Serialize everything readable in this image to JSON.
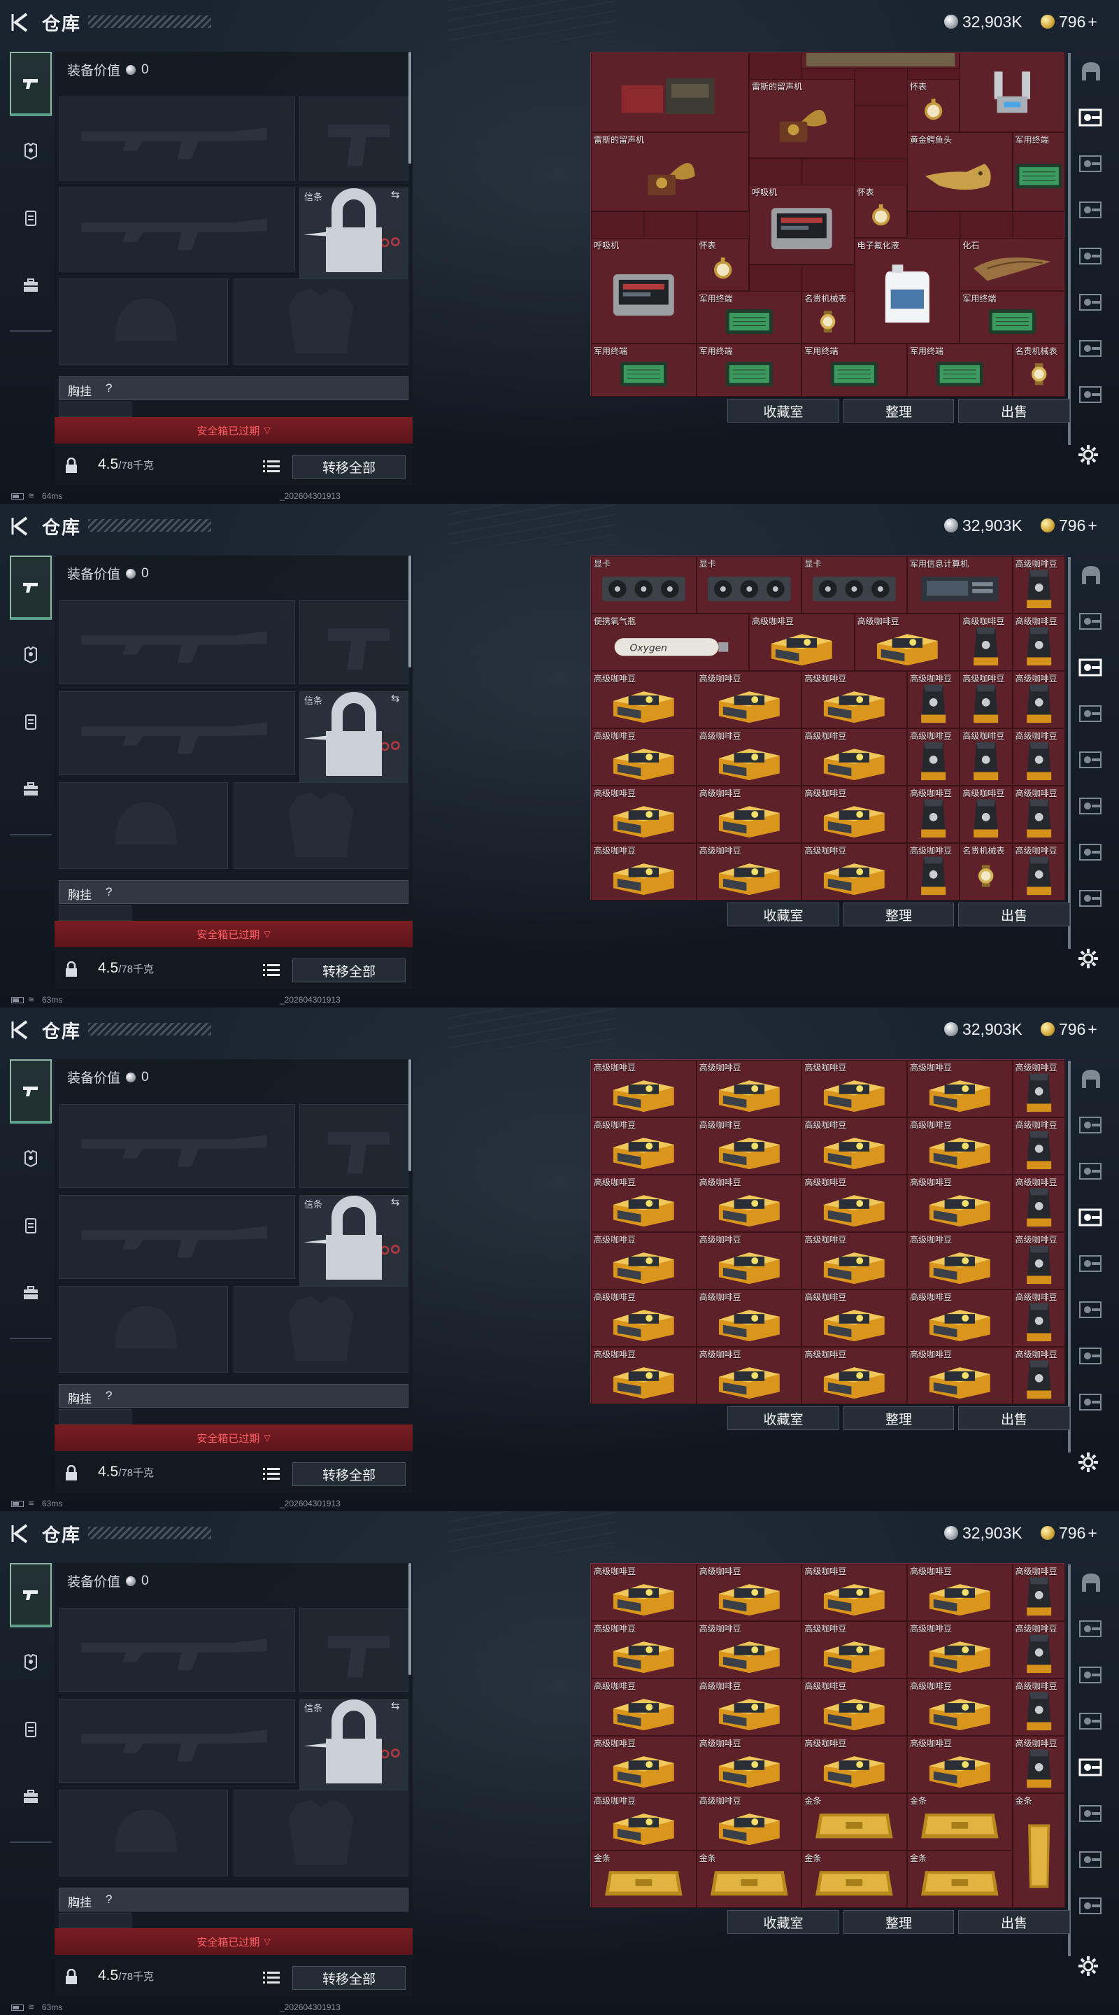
{
  "header": {
    "title": "仓库",
    "silver": "32,903K",
    "gold": "796",
    "gold_plus": "+"
  },
  "loadout": {
    "equip_value_label": "装备价值",
    "equip_value": "0",
    "melee_label": "信条",
    "vest_label": "胸挂",
    "vest_value": "?",
    "safebox_text": "安全箱已过期",
    "weight_value": "4.5",
    "weight_max": "/78千克",
    "transfer_all": "转移全部"
  },
  "status": {
    "ping": [
      "64ms",
      "63ms",
      "63ms",
      "63ms"
    ],
    "uid": "_202604301913"
  },
  "buttons": {
    "collection": "收藏室",
    "sort": "整理",
    "sell": "出售"
  },
  "rail_icons": [
    "helmet-icon",
    "key-icon",
    "key-icon",
    "key-icon",
    "key-icon",
    "key-icon",
    "key-icon",
    "key-icon"
  ],
  "colors": {
    "grid_bg": "#571a22",
    "safebox": "#7a1d22",
    "active_tab": "#5c9f88"
  },
  "panels": [
    {
      "rail_active": 1,
      "items": [
        {
          "label": "",
          "icon": "radio-device",
          "c": 0,
          "r": 0,
          "w": 3,
          "h": 1.5
        },
        {
          "label": "",
          "icon": "crate",
          "c": 4,
          "r": 0,
          "w": 3,
          "h": 0.3
        },
        {
          "label": "",
          "icon": "robot-arm",
          "c": 7,
          "r": 0,
          "w": 2,
          "h": 1.5
        },
        {
          "label": "雷斯的留声机",
          "icon": "gramophone",
          "c": 3,
          "r": 0.5,
          "w": 2,
          "h": 1.5
        },
        {
          "label": "怀表",
          "icon": "pocket-watch",
          "c": 6,
          "r": 0.5,
          "w": 1,
          "h": 1
        },
        {
          "label": "雷斯的留声机",
          "icon": "gramophone",
          "c": 0,
          "r": 1.5,
          "w": 3,
          "h": 1.5
        },
        {
          "label": "黄金鳄鱼头",
          "icon": "croc-head",
          "c": 6,
          "r": 1.5,
          "w": 2,
          "h": 1.5
        },
        {
          "label": "军用终端",
          "icon": "terminal",
          "c": 8,
          "r": 1.5,
          "w": 1,
          "h": 1.5
        },
        {
          "label": "呼吸机",
          "icon": "respirator",
          "c": 3,
          "r": 2.5,
          "w": 2,
          "h": 1.5
        },
        {
          "label": "怀表",
          "icon": "pocket-watch",
          "c": 5,
          "r": 2.5,
          "w": 1,
          "h": 1
        },
        {
          "label": "呼吸机",
          "icon": "respirator",
          "c": 0,
          "r": 3.5,
          "w": 2,
          "h": 2
        },
        {
          "label": "怀表",
          "icon": "pocket-watch",
          "c": 2,
          "r": 3.5,
          "w": 1,
          "h": 1
        },
        {
          "label": "电子氟化液",
          "icon": "jug",
          "c": 5,
          "r": 3.5,
          "w": 2,
          "h": 2
        },
        {
          "label": "化石",
          "icon": "fossil",
          "c": 7,
          "r": 3.5,
          "w": 2,
          "h": 1
        },
        {
          "label": "军用终端",
          "icon": "terminal",
          "c": 2,
          "r": 4.5,
          "w": 2,
          "h": 1
        },
        {
          "label": "名贵机械表",
          "icon": "watch",
          "c": 4,
          "r": 4.5,
          "w": 1,
          "h": 1
        },
        {
          "label": "军用终端",
          "icon": "terminal",
          "c": 7,
          "r": 4.5,
          "w": 2,
          "h": 1
        },
        {
          "label": "军用终端",
          "icon": "terminal",
          "c": 0,
          "r": 5.5,
          "w": 2,
          "h": 1
        },
        {
          "label": "军用终端",
          "icon": "terminal",
          "c": 2,
          "r": 5.5,
          "w": 2,
          "h": 1
        },
        {
          "label": "军用终端",
          "icon": "terminal",
          "c": 4,
          "r": 5.5,
          "w": 2,
          "h": 1
        },
        {
          "label": "军用终端",
          "icon": "terminal",
          "c": 6,
          "r": 5.5,
          "w": 2,
          "h": 1
        },
        {
          "label": "名贵机械表",
          "icon": "watch",
          "c": 8,
          "r": 5.5,
          "w": 1,
          "h": 1
        }
      ],
      "grid_rows": 6.5
    },
    {
      "rail_active": 2,
      "items": [
        {
          "label": "显卡",
          "icon": "gpu",
          "c": 0,
          "r": 0,
          "w": 2,
          "h": 1
        },
        {
          "label": "显卡",
          "icon": "gpu",
          "c": 2,
          "r": 0,
          "w": 2,
          "h": 1
        },
        {
          "label": "显卡",
          "icon": "gpu",
          "c": 4,
          "r": 0,
          "w": 2,
          "h": 1
        },
        {
          "label": "军用信息计算机",
          "icon": "computer",
          "c": 6,
          "r": 0,
          "w": 2,
          "h": 1
        },
        {
          "label": "高级咖啡豆",
          "icon": "coffee-bag",
          "c": 8,
          "r": 0,
          "w": 1,
          "h": 1
        },
        {
          "label": "便携氧气瓶",
          "icon": "oxygen",
          "c": 0,
          "r": 1,
          "w": 3,
          "h": 1
        },
        {
          "label": "高级咖啡豆",
          "icon": "coffee-box",
          "c": 3,
          "r": 1,
          "w": 2,
          "h": 1
        },
        {
          "label": "高级咖啡豆",
          "icon": "coffee-box",
          "c": 5,
          "r": 1,
          "w": 2,
          "h": 1
        },
        {
          "label": "高级咖啡豆",
          "icon": "coffee-bag",
          "c": 7,
          "r": 1,
          "w": 1,
          "h": 1
        },
        {
          "label": "高级咖啡豆",
          "icon": "coffee-bag",
          "c": 8,
          "r": 1,
          "w": 1,
          "h": 1
        },
        {
          "label": "高级咖啡豆",
          "icon": "coffee-box",
          "c": 0,
          "r": 2,
          "w": 2,
          "h": 1
        },
        {
          "label": "高级咖啡豆",
          "icon": "coffee-box",
          "c": 2,
          "r": 2,
          "w": 2,
          "h": 1
        },
        {
          "label": "高级咖啡豆",
          "icon": "coffee-box",
          "c": 4,
          "r": 2,
          "w": 2,
          "h": 1
        },
        {
          "label": "高级咖啡豆",
          "icon": "coffee-bag",
          "c": 6,
          "r": 2,
          "w": 1,
          "h": 1
        },
        {
          "label": "高级咖啡豆",
          "icon": "coffee-bag",
          "c": 7,
          "r": 2,
          "w": 1,
          "h": 1
        },
        {
          "label": "高级咖啡豆",
          "icon": "coffee-bag",
          "c": 8,
          "r": 2,
          "w": 1,
          "h": 1
        },
        {
          "label": "高级咖啡豆",
          "icon": "coffee-box",
          "c": 0,
          "r": 3,
          "w": 2,
          "h": 1
        },
        {
          "label": "高级咖啡豆",
          "icon": "coffee-box",
          "c": 2,
          "r": 3,
          "w": 2,
          "h": 1
        },
        {
          "label": "高级咖啡豆",
          "icon": "coffee-box",
          "c": 4,
          "r": 3,
          "w": 2,
          "h": 1
        },
        {
          "label": "高级咖啡豆",
          "icon": "coffee-bag",
          "c": 6,
          "r": 3,
          "w": 1,
          "h": 1
        },
        {
          "label": "高级咖啡豆",
          "icon": "coffee-bag",
          "c": 7,
          "r": 3,
          "w": 1,
          "h": 1
        },
        {
          "label": "高级咖啡豆",
          "icon": "coffee-bag",
          "c": 8,
          "r": 3,
          "w": 1,
          "h": 1
        },
        {
          "label": "高级咖啡豆",
          "icon": "coffee-box",
          "c": 0,
          "r": 4,
          "w": 2,
          "h": 1
        },
        {
          "label": "高级咖啡豆",
          "icon": "coffee-box",
          "c": 2,
          "r": 4,
          "w": 2,
          "h": 1
        },
        {
          "label": "高级咖啡豆",
          "icon": "coffee-box",
          "c": 4,
          "r": 4,
          "w": 2,
          "h": 1
        },
        {
          "label": "高级咖啡豆",
          "icon": "coffee-bag",
          "c": 6,
          "r": 4,
          "w": 1,
          "h": 1
        },
        {
          "label": "高级咖啡豆",
          "icon": "coffee-bag",
          "c": 7,
          "r": 4,
          "w": 1,
          "h": 1
        },
        {
          "label": "高级咖啡豆",
          "icon": "coffee-bag",
          "c": 8,
          "r": 4,
          "w": 1,
          "h": 1
        },
        {
          "label": "高级咖啡豆",
          "icon": "coffee-box",
          "c": 0,
          "r": 5,
          "w": 2,
          "h": 1
        },
        {
          "label": "高级咖啡豆",
          "icon": "coffee-box",
          "c": 2,
          "r": 5,
          "w": 2,
          "h": 1
        },
        {
          "label": "高级咖啡豆",
          "icon": "coffee-box",
          "c": 4,
          "r": 5,
          "w": 2,
          "h": 1
        },
        {
          "label": "高级咖啡豆",
          "icon": "coffee-bag",
          "c": 6,
          "r": 5,
          "w": 1,
          "h": 1
        },
        {
          "label": "名贵机械表",
          "icon": "watch",
          "c": 7,
          "r": 5,
          "w": 1,
          "h": 1
        },
        {
          "label": "高级咖啡豆",
          "icon": "coffee-bag",
          "c": 8,
          "r": 5,
          "w": 1,
          "h": 1
        }
      ],
      "grid_rows": 6
    },
    {
      "rail_active": 3,
      "items": [
        {
          "label": "高级咖啡豆",
          "icon": "coffee-box",
          "c": 0,
          "r": 0,
          "w": 2,
          "h": 1
        },
        {
          "label": "高级咖啡豆",
          "icon": "coffee-box",
          "c": 2,
          "r": 0,
          "w": 2,
          "h": 1
        },
        {
          "label": "高级咖啡豆",
          "icon": "coffee-box",
          "c": 4,
          "r": 0,
          "w": 2,
          "h": 1
        },
        {
          "label": "高级咖啡豆",
          "icon": "coffee-box",
          "c": 6,
          "r": 0,
          "w": 2,
          "h": 1
        },
        {
          "label": "高级咖啡豆",
          "icon": "coffee-bag",
          "c": 8,
          "r": 0,
          "w": 1,
          "h": 1
        },
        {
          "label": "高级咖啡豆",
          "icon": "coffee-box",
          "c": 0,
          "r": 1,
          "w": 2,
          "h": 1
        },
        {
          "label": "高级咖啡豆",
          "icon": "coffee-box",
          "c": 2,
          "r": 1,
          "w": 2,
          "h": 1
        },
        {
          "label": "高级咖啡豆",
          "icon": "coffee-box",
          "c": 4,
          "r": 1,
          "w": 2,
          "h": 1
        },
        {
          "label": "高级咖啡豆",
          "icon": "coffee-box",
          "c": 6,
          "r": 1,
          "w": 2,
          "h": 1
        },
        {
          "label": "高级咖啡豆",
          "icon": "coffee-bag",
          "c": 8,
          "r": 1,
          "w": 1,
          "h": 1
        },
        {
          "label": "高级咖啡豆",
          "icon": "coffee-box",
          "c": 0,
          "r": 2,
          "w": 2,
          "h": 1
        },
        {
          "label": "高级咖啡豆",
          "icon": "coffee-box",
          "c": 2,
          "r": 2,
          "w": 2,
          "h": 1
        },
        {
          "label": "高级咖啡豆",
          "icon": "coffee-box",
          "c": 4,
          "r": 2,
          "w": 2,
          "h": 1
        },
        {
          "label": "高级咖啡豆",
          "icon": "coffee-box",
          "c": 6,
          "r": 2,
          "w": 2,
          "h": 1
        },
        {
          "label": "高级咖啡豆",
          "icon": "coffee-bag",
          "c": 8,
          "r": 2,
          "w": 1,
          "h": 1
        },
        {
          "label": "高级咖啡豆",
          "icon": "coffee-box",
          "c": 0,
          "r": 3,
          "w": 2,
          "h": 1
        },
        {
          "label": "高级咖啡豆",
          "icon": "coffee-box",
          "c": 2,
          "r": 3,
          "w": 2,
          "h": 1
        },
        {
          "label": "高级咖啡豆",
          "icon": "coffee-box",
          "c": 4,
          "r": 3,
          "w": 2,
          "h": 1
        },
        {
          "label": "高级咖啡豆",
          "icon": "coffee-box",
          "c": 6,
          "r": 3,
          "w": 2,
          "h": 1
        },
        {
          "label": "高级咖啡豆",
          "icon": "coffee-bag",
          "c": 8,
          "r": 3,
          "w": 1,
          "h": 1
        },
        {
          "label": "高级咖啡豆",
          "icon": "coffee-box",
          "c": 0,
          "r": 4,
          "w": 2,
          "h": 1
        },
        {
          "label": "高级咖啡豆",
          "icon": "coffee-box",
          "c": 2,
          "r": 4,
          "w": 2,
          "h": 1
        },
        {
          "label": "高级咖啡豆",
          "icon": "coffee-box",
          "c": 4,
          "r": 4,
          "w": 2,
          "h": 1
        },
        {
          "label": "高级咖啡豆",
          "icon": "coffee-box",
          "c": 6,
          "r": 4,
          "w": 2,
          "h": 1
        },
        {
          "label": "高级咖啡豆",
          "icon": "coffee-bag",
          "c": 8,
          "r": 4,
          "w": 1,
          "h": 1
        },
        {
          "label": "高级咖啡豆",
          "icon": "coffee-box",
          "c": 0,
          "r": 5,
          "w": 2,
          "h": 1
        },
        {
          "label": "高级咖啡豆",
          "icon": "coffee-box",
          "c": 2,
          "r": 5,
          "w": 2,
          "h": 1
        },
        {
          "label": "高级咖啡豆",
          "icon": "coffee-box",
          "c": 4,
          "r": 5,
          "w": 2,
          "h": 1
        },
        {
          "label": "高级咖啡豆",
          "icon": "coffee-box",
          "c": 6,
          "r": 5,
          "w": 2,
          "h": 1
        },
        {
          "label": "高级咖啡豆",
          "icon": "coffee-bag",
          "c": 8,
          "r": 5,
          "w": 1,
          "h": 1
        }
      ],
      "grid_rows": 6
    },
    {
      "rail_active": 4,
      "items": [
        {
          "label": "高级咖啡豆",
          "icon": "coffee-box",
          "c": 0,
          "r": 0,
          "w": 2,
          "h": 1
        },
        {
          "label": "高级咖啡豆",
          "icon": "coffee-box",
          "c": 2,
          "r": 0,
          "w": 2,
          "h": 1
        },
        {
          "label": "高级咖啡豆",
          "icon": "coffee-box",
          "c": 4,
          "r": 0,
          "w": 2,
          "h": 1
        },
        {
          "label": "高级咖啡豆",
          "icon": "coffee-box",
          "c": 6,
          "r": 0,
          "w": 2,
          "h": 1
        },
        {
          "label": "高级咖啡豆",
          "icon": "coffee-bag",
          "c": 8,
          "r": 0,
          "w": 1,
          "h": 1
        },
        {
          "label": "高级咖啡豆",
          "icon": "coffee-box",
          "c": 0,
          "r": 1,
          "w": 2,
          "h": 1
        },
        {
          "label": "高级咖啡豆",
          "icon": "coffee-box",
          "c": 2,
          "r": 1,
          "w": 2,
          "h": 1
        },
        {
          "label": "高级咖啡豆",
          "icon": "coffee-box",
          "c": 4,
          "r": 1,
          "w": 2,
          "h": 1
        },
        {
          "label": "高级咖啡豆",
          "icon": "coffee-box",
          "c": 6,
          "r": 1,
          "w": 2,
          "h": 1
        },
        {
          "label": "高级咖啡豆",
          "icon": "coffee-bag",
          "c": 8,
          "r": 1,
          "w": 1,
          "h": 1
        },
        {
          "label": "高级咖啡豆",
          "icon": "coffee-box",
          "c": 0,
          "r": 2,
          "w": 2,
          "h": 1
        },
        {
          "label": "高级咖啡豆",
          "icon": "coffee-box",
          "c": 2,
          "r": 2,
          "w": 2,
          "h": 1
        },
        {
          "label": "高级咖啡豆",
          "icon": "coffee-box",
          "c": 4,
          "r": 2,
          "w": 2,
          "h": 1
        },
        {
          "label": "高级咖啡豆",
          "icon": "coffee-box",
          "c": 6,
          "r": 2,
          "w": 2,
          "h": 1
        },
        {
          "label": "高级咖啡豆",
          "icon": "coffee-bag",
          "c": 8,
          "r": 2,
          "w": 1,
          "h": 1
        },
        {
          "label": "高级咖啡豆",
          "icon": "coffee-box",
          "c": 0,
          "r": 3,
          "w": 2,
          "h": 1
        },
        {
          "label": "高级咖啡豆",
          "icon": "coffee-box",
          "c": 2,
          "r": 3,
          "w": 2,
          "h": 1
        },
        {
          "label": "高级咖啡豆",
          "icon": "coffee-box",
          "c": 4,
          "r": 3,
          "w": 2,
          "h": 1
        },
        {
          "label": "高级咖啡豆",
          "icon": "coffee-box",
          "c": 6,
          "r": 3,
          "w": 2,
          "h": 1
        },
        {
          "label": "高级咖啡豆",
          "icon": "coffee-bag",
          "c": 8,
          "r": 3,
          "w": 1,
          "h": 1
        },
        {
          "label": "高级咖啡豆",
          "icon": "coffee-box",
          "c": 0,
          "r": 4,
          "w": 2,
          "h": 1
        },
        {
          "label": "高级咖啡豆",
          "icon": "coffee-box",
          "c": 2,
          "r": 4,
          "w": 2,
          "h": 1
        },
        {
          "label": "金条",
          "icon": "gold-bar",
          "c": 4,
          "r": 4,
          "w": 2,
          "h": 1
        },
        {
          "label": "金条",
          "icon": "gold-bar",
          "c": 6,
          "r": 4,
          "w": 2,
          "h": 1
        },
        {
          "label": "金条",
          "icon": "gold-bar-v",
          "c": 8,
          "r": 4,
          "w": 1,
          "h": 2
        },
        {
          "label": "金条",
          "icon": "gold-bar",
          "c": 0,
          "r": 5,
          "w": 2,
          "h": 1
        },
        {
          "label": "金条",
          "icon": "gold-bar",
          "c": 2,
          "r": 5,
          "w": 2,
          "h": 1
        },
        {
          "label": "金条",
          "icon": "gold-bar",
          "c": 4,
          "r": 5,
          "w": 2,
          "h": 1
        },
        {
          "label": "金条",
          "icon": "gold-bar",
          "c": 6,
          "r": 5,
          "w": 2,
          "h": 1
        }
      ],
      "grid_rows": 6
    }
  ]
}
